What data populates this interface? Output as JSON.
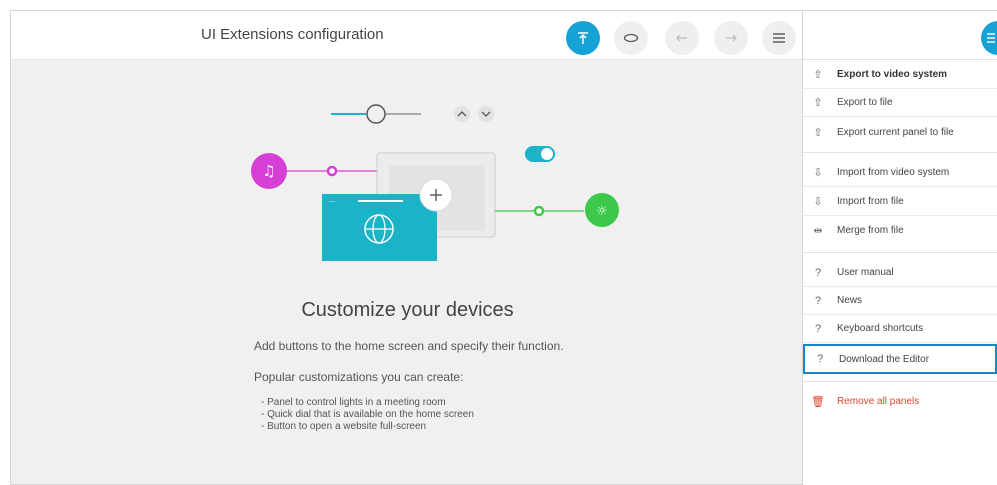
{
  "header": {
    "title": "UI Extensions configuration"
  },
  "toolbar": {
    "buttons": [
      {
        "name": "upload-icon",
        "active": true
      },
      {
        "name": "preview-icon",
        "active": false
      },
      {
        "name": "undo-icon",
        "active": false
      },
      {
        "name": "redo-icon",
        "active": false
      },
      {
        "name": "menu-icon",
        "active": false
      }
    ]
  },
  "main": {
    "headline": "Customize your devices",
    "paragraph1": "Add buttons to the home screen and specify their function.",
    "paragraph2": "Popular customizations you can create:",
    "bullets": [
      "Panel to control lights in a meeting room",
      "Quick dial that is available on the home screen",
      "Button to open a website full-screen"
    ]
  },
  "menu": {
    "items": [
      {
        "label": "Export to video system",
        "icon": "export-icon"
      },
      {
        "label": "Export to file",
        "icon": "export-icon"
      },
      {
        "label": "Export current panel to file",
        "icon": "export-icon"
      },
      {
        "label": "Import from video system",
        "icon": "import-icon"
      },
      {
        "label": "Import from file",
        "icon": "import-icon"
      },
      {
        "label": "Merge from file",
        "icon": "merge-icon"
      },
      {
        "label": "User manual",
        "icon": "help-icon"
      },
      {
        "label": "News",
        "icon": "help-icon"
      },
      {
        "label": "Keyboard shortcuts",
        "icon": "help-icon"
      },
      {
        "label": "Download the Editor",
        "icon": "help-icon"
      },
      {
        "label": "Remove all panels",
        "icon": "trash-icon"
      }
    ]
  },
  "colors": {
    "accent": "#17a2d6",
    "highlight_border": "#1a86c8",
    "danger": "#e0462c",
    "music": "#d63fd6",
    "light": "#3cc84a",
    "panel": "#1bb3c8"
  }
}
